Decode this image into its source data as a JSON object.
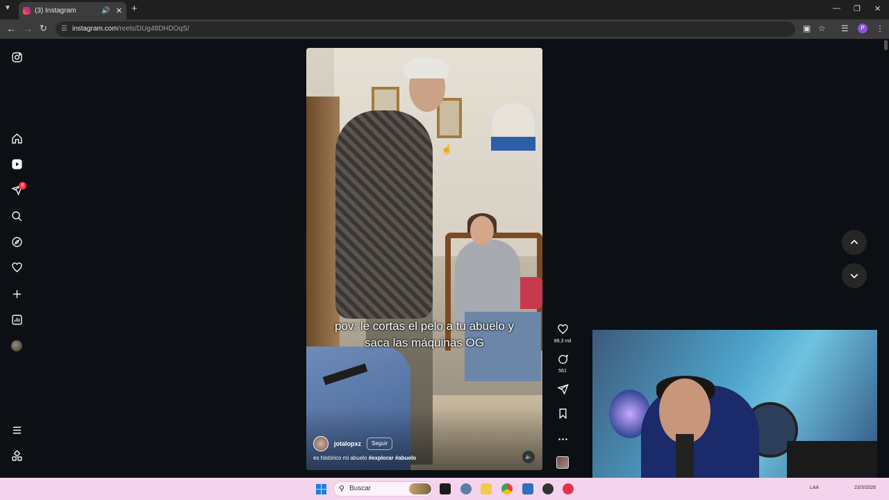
{
  "browser": {
    "tab_title": "(3) Instagram",
    "url_host": "instagram.com",
    "url_path": "/reels/DUg48DHDOqS/",
    "profile_initial": "P"
  },
  "sidebar": {
    "items": [
      {
        "name": "instagram-logo-icon"
      },
      {
        "name": "home-icon"
      },
      {
        "name": "reels-icon"
      },
      {
        "name": "direct-messages-icon"
      },
      {
        "name": "search-icon"
      },
      {
        "name": "explore-icon"
      },
      {
        "name": "notifications-heart-icon"
      },
      {
        "name": "create-plus-icon"
      },
      {
        "name": "dashboard-icon"
      },
      {
        "name": "profile-avatar"
      },
      {
        "name": "more-menu-icon"
      },
      {
        "name": "also-from-meta-icon"
      }
    ],
    "messages_badge": "6"
  },
  "reel": {
    "caption_overlay": "pov: le cortas el pelo a tu abuelo y saca las máquinas OG",
    "author": "jotalopxz",
    "follow_label": "Seguir",
    "description_text": "es histórico mi abuelo ",
    "hashtags": "#explorar #abuelo"
  },
  "actions": {
    "likes": "89,3 mil",
    "comments": "561"
  },
  "taskbar": {
    "search_placeholder": "Buscar",
    "tray_lang": "LAA",
    "date": "23/3/2026"
  },
  "colors": {
    "page_bg": "#0c1014",
    "taskbar_bg": "#f3d4ec",
    "badge": "#ff3040"
  }
}
